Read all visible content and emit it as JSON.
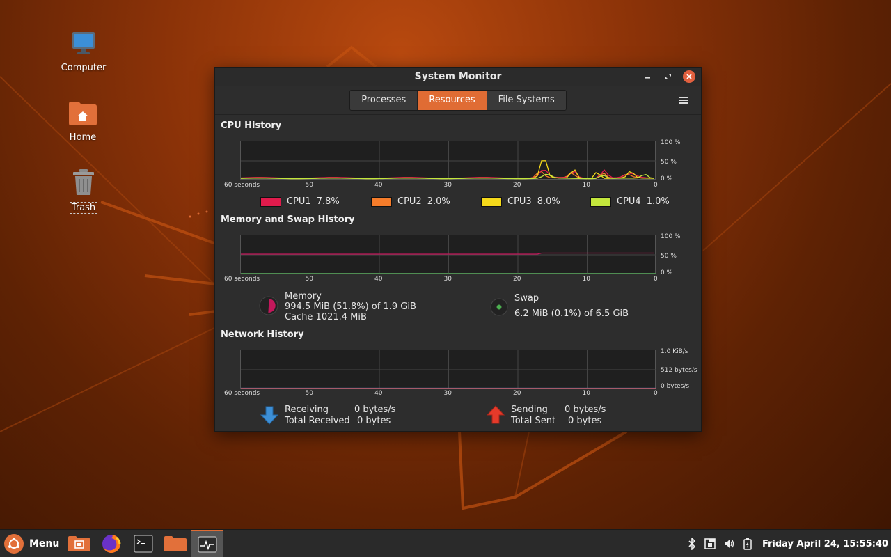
{
  "desktop": {
    "icons": [
      {
        "label": "Computer"
      },
      {
        "label": "Home"
      },
      {
        "label": "Trash"
      }
    ]
  },
  "window": {
    "title": "System Monitor",
    "tabs": [
      {
        "label": "Processes",
        "active": false
      },
      {
        "label": "Resources",
        "active": true
      },
      {
        "label": "File Systems",
        "active": false
      }
    ],
    "x_axis": {
      "start_label": "60 seconds",
      "ticks": [
        "50",
        "40",
        "30",
        "20",
        "10",
        "0"
      ]
    },
    "cpu": {
      "title": "CPU History",
      "y_ticks": [
        "100 %",
        "50 %",
        "0 %"
      ],
      "series": [
        {
          "name": "CPU1",
          "value": "7.8%",
          "color": "#e01b4c"
        },
        {
          "name": "CPU2",
          "value": "2.0%",
          "color": "#f57c2a"
        },
        {
          "name": "CPU3",
          "value": "8.0%",
          "color": "#f5d91a"
        },
        {
          "name": "CPU4",
          "value": "1.0%",
          "color": "#c3e63c"
        }
      ]
    },
    "memory": {
      "title": "Memory and Swap History",
      "y_ticks": [
        "100 %",
        "50 %",
        "0 %"
      ],
      "mem_label": "Memory",
      "mem_value": "994.5 MiB (51.8%) of 1.9 GiB",
      "mem_cache": "Cache 1021.4 MiB",
      "mem_color": "#c2185b",
      "swap_label": "Swap",
      "swap_value": "6.2 MiB (0.1%) of 6.5 GiB",
      "swap_color": "#4caf50"
    },
    "network": {
      "title": "Network History",
      "y_ticks": [
        "1.0 KiB/s",
        "512 bytes/s",
        "0 bytes/s"
      ],
      "receiving_label": "Receiving",
      "receiving_value": "0 bytes/s",
      "total_received_label": "Total Received",
      "total_received_value": "0 bytes",
      "sending_label": "Sending",
      "sending_value": "0 bytes/s",
      "total_sent_label": "Total Sent",
      "total_sent_value": "0 bytes"
    }
  },
  "taskbar": {
    "menu_label": "Menu",
    "clock": "Friday April 24, 15:55:40"
  }
}
